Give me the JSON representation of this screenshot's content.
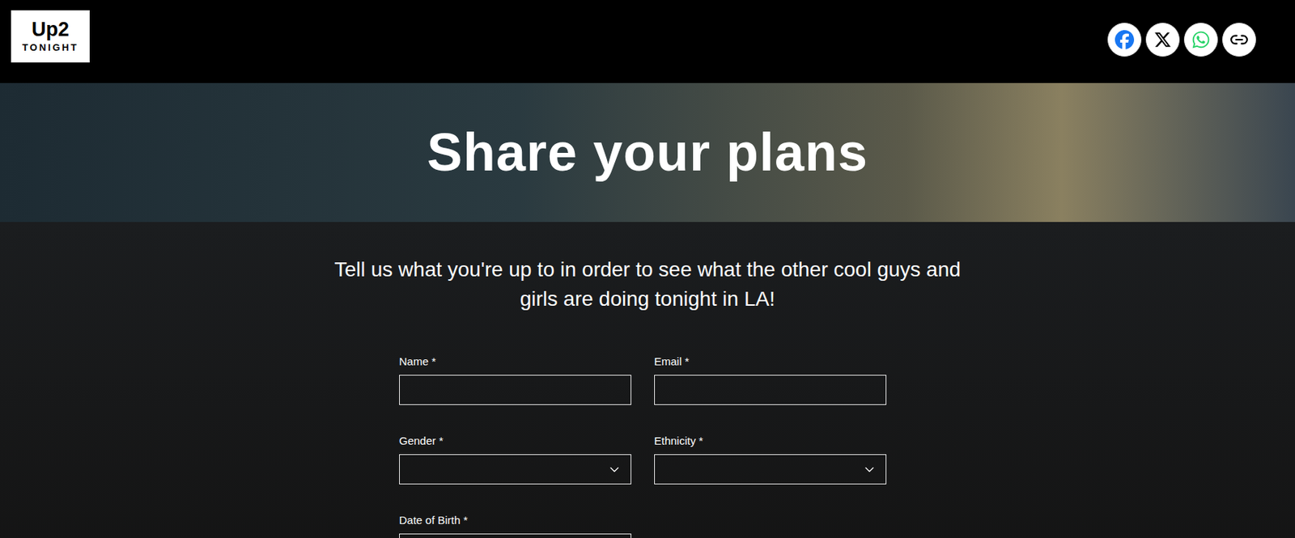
{
  "logo": {
    "line1": "Up2",
    "line2": "TONIGHT"
  },
  "hero": {
    "title": "Share your plans"
  },
  "form": {
    "intro": "Tell us what you're up to in order to see what the other cool guys and girls are doing tonight in LA!",
    "fields": [
      {
        "label": "Name *",
        "kind": "text"
      },
      {
        "label": "Email *",
        "kind": "text"
      },
      {
        "label": "Gender *",
        "kind": "select"
      },
      {
        "label": "Ethnicity *",
        "kind": "select"
      },
      {
        "label": "Date of Birth *",
        "kind": "text"
      }
    ]
  }
}
